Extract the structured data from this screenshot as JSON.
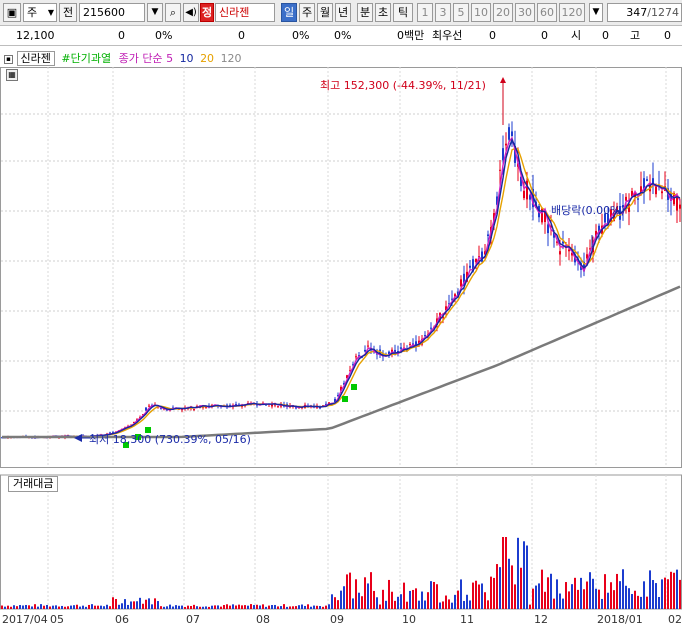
{
  "toolbar": {
    "type_label": "주",
    "prev_label": "전",
    "code_value": "215600",
    "stock_badge": "정",
    "stock_name": "신라젠",
    "periods": [
      "일",
      "주",
      "월",
      "년",
      "분",
      "초",
      "틱"
    ],
    "active_period": "일",
    "minutes": [
      "1",
      "3",
      "5",
      "10",
      "20",
      "30",
      "60",
      "120"
    ],
    "page_current": "347",
    "page_total": "/1274"
  },
  "info": {
    "price": "12,100",
    "change": "0",
    "change_pct": "0%",
    "volume": "0",
    "vol_pct": "0%",
    "amount_pct": "0%",
    "amount_label": "0백만",
    "priority_label": "최우선",
    "priority_a": "0",
    "priority_b": "0",
    "open_label": "시",
    "open_value": "0",
    "high_label": "고",
    "high_value": "0"
  },
  "legend": {
    "tab": "신라젠",
    "pattern": "#단기과열",
    "ma_title": "종가 단순",
    "ma_periods": [
      "5",
      "10",
      "20",
      "120"
    ],
    "colors": {
      "ma5": "#d11fc3",
      "ma10": "#1428a0",
      "ma20": "#e6a100",
      "ma120": "#7a7a7a",
      "pattern": "#00c800"
    }
  },
  "annotations": {
    "high": "최고 152,300 (-44.39%, 11/21)",
    "low": "최저 18,300 (730.39%, 05/16)",
    "dividend": "배당락(0.00%)"
  },
  "volume_panel": {
    "title": "거래대금"
  },
  "chart_data": {
    "type": "candlestick",
    "x_axis_labels": [
      "2017/04",
      "05",
      "06",
      "07",
      "08",
      "09",
      "10",
      "11",
      "12",
      "2018/01",
      "02"
    ],
    "series": [
      {
        "name": "5"
      },
      {
        "name": "10"
      },
      {
        "name": "20"
      },
      {
        "name": "120"
      }
    ],
    "colors": {
      "up": "#e8001a",
      "down": "#1c3ccf"
    },
    "price_range_approx": [
      0,
      155000
    ],
    "grid": true
  }
}
